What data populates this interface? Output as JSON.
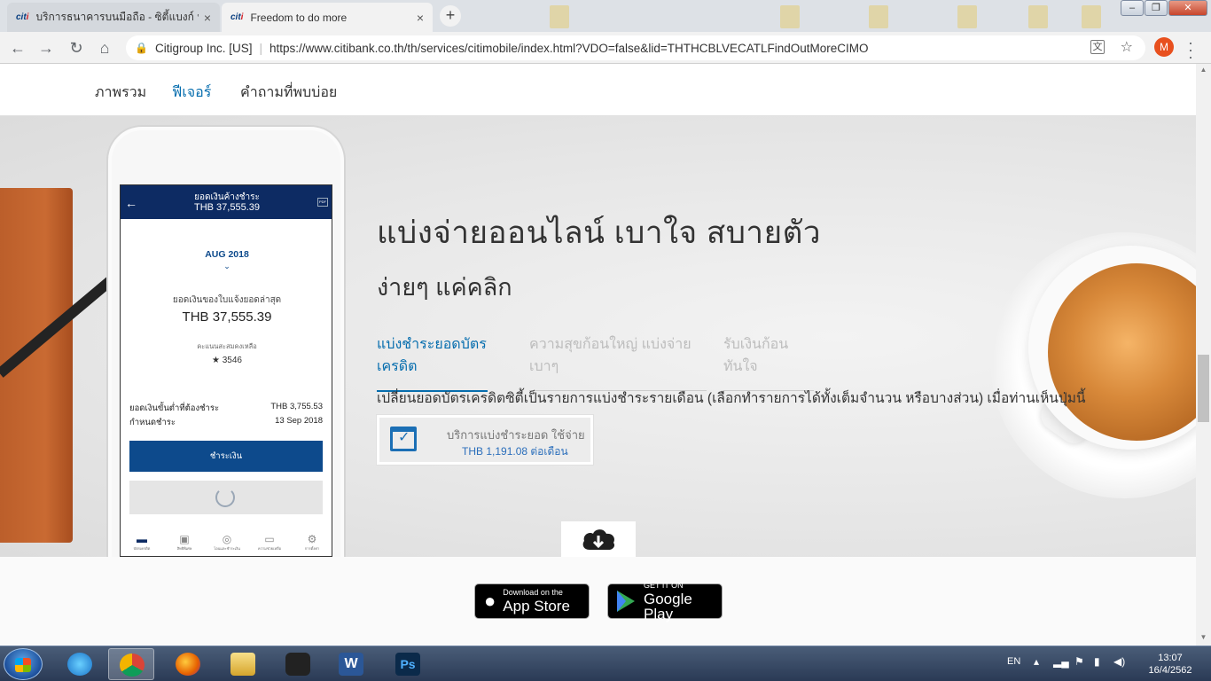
{
  "browser": {
    "tabs": [
      {
        "favicon": "citi",
        "title": "บริการธนาคารบนมือถือ - ซิตี้แบงก์ ประเทศไทย",
        "close": "×"
      },
      {
        "favicon": "citi",
        "title": "Freedom to do more",
        "close": "×"
      }
    ],
    "new_tab": "+",
    "window_controls": {
      "minimize": "–",
      "restore": "❐",
      "close": "✕"
    },
    "nav": {
      "back": "←",
      "forward": "→",
      "reload": "↻",
      "home": "⌂"
    },
    "address": {
      "org": "Citigroup Inc. [US]",
      "url": "https://www.citibank.co.th/th/services/citimobile/index.html?VDO=false&lid=THTHCBLVECATLFindOutMoreCIMO"
    },
    "profile_initial": "M"
  },
  "subnav": {
    "items": [
      "ภาพรวม",
      "ฟีเจอร์",
      "คำถามที่พบบ่อย"
    ],
    "active_index": 1
  },
  "phone": {
    "header_title": "ยอดเงินค้างชำระ",
    "header_amount": "THB 37,555.39",
    "month": "AUG 2018",
    "statement_label": "ยอดเงินของใบแจ้งยอดล่าสุด",
    "statement_amount": "THB 37,555.39",
    "points_label": "คะแนนสะสมคงเหลือ",
    "points": "★ 3546",
    "min_due_label": "ยอดเงินขั้นต่ำที่ต้องชำระ",
    "min_due_value": "THB 3,755.53",
    "due_date_label": "กำหนดชำระ",
    "due_date_value": "13 Sep 2018",
    "pay_button": "ชำระเงิน",
    "tabbar": [
      {
        "icon": "card-icon",
        "label": "บัตรเครดิต"
      },
      {
        "icon": "gift-icon",
        "label": "สิทธิพิเศษ"
      },
      {
        "icon": "transfer-icon",
        "label": "โอนและชำระเงิน"
      },
      {
        "icon": "chat-icon",
        "label": "ความช่วยเหลือ"
      },
      {
        "icon": "gear-icon",
        "label": "การตั้งค่า"
      }
    ]
  },
  "hero": {
    "headline": "แบ่งจ่ายออนไลน์ เบาใจ สบายตัว",
    "subhead": "ง่ายๆ แค่คลิก",
    "feature_tabs": [
      "แบ่งชำระยอดบัตรเครดิต",
      "ความสุขก้อนใหญ่ แบ่งจ่ายเบาๆ",
      "รับเงินก้อนทันใจ"
    ],
    "active_feature_tab": 0,
    "description": "เปลี่ยนยอดบัตรเครดิตซิตี้เป็นรายการแบ่งชำระรายเดือน (เลือกทำรายการได้ทั้งเต็มจำนวน หรือบางส่วน) เมื่อท่านเห็นปุ่มนี้",
    "demo_button": {
      "line1": "บริการแบ่งชำระยอด ใช้จ่าย",
      "line2": "THB  1,191.08 ต่อเดือน"
    }
  },
  "stores": {
    "apple": {
      "small": "Download on the",
      "big": "App Store"
    },
    "google": {
      "small": "GET IT ON",
      "big": "Google Play"
    }
  },
  "taskbar": {
    "language": "EN",
    "time": "13:07",
    "date": "16/4/2562"
  },
  "colors": {
    "citi_blue": "#056dae",
    "citi_navy": "#0d2b63",
    "text_dark": "#333333",
    "muted_tab": "#bcbcbc"
  }
}
